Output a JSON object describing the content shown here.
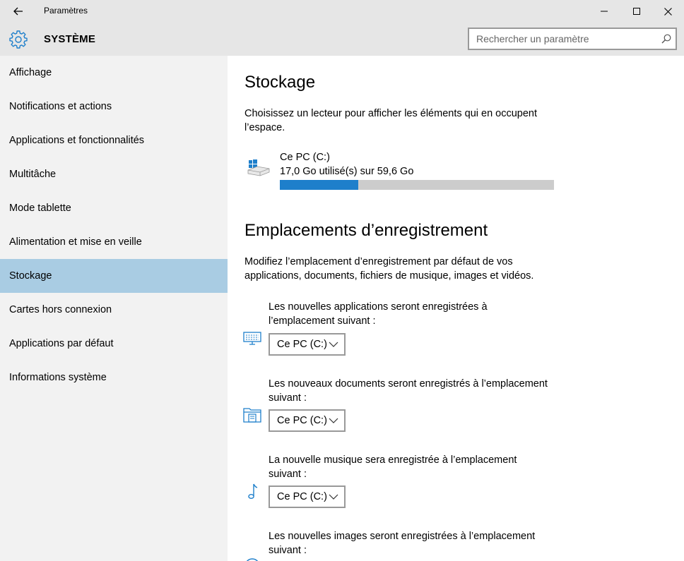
{
  "window": {
    "title": "Paramètres"
  },
  "header": {
    "section_title": "SYSTÈME",
    "search_placeholder": "Rechercher un paramètre"
  },
  "sidebar": {
    "items": [
      {
        "label": "Affichage",
        "active": false
      },
      {
        "label": "Notifications et actions",
        "active": false
      },
      {
        "label": "Applications et fonctionnalités",
        "active": false
      },
      {
        "label": "Multitâche",
        "active": false
      },
      {
        "label": "Mode tablette",
        "active": false
      },
      {
        "label": "Alimentation et mise en veille",
        "active": false
      },
      {
        "label": "Stockage",
        "active": true
      },
      {
        "label": "Cartes hors connexion",
        "active": false
      },
      {
        "label": "Applications par défaut",
        "active": false
      },
      {
        "label": "Informations système",
        "active": false
      }
    ]
  },
  "storage": {
    "title": "Stockage",
    "description": "Choisissez un lecteur pour afficher les éléments qui en occupent l’espace.",
    "drive": {
      "name": "Ce PC (C:)",
      "usage_text": "17,0 Go utilisé(s) sur 59,6 Go",
      "used_fraction": 0.285
    }
  },
  "save_locations": {
    "title": "Emplacements d’enregistrement",
    "description": "Modifiez l’emplacement d’enregistrement par défaut de vos applications, documents, fichiers de musique, images et vidéos.",
    "items": [
      {
        "label": "Les nouvelles applications seront enregistrées à l’emplacement suivant :",
        "value": "Ce PC (C:)",
        "icon": "monitor-icon"
      },
      {
        "label": "Les nouveaux documents seront enregistrés à l’emplacement suivant :",
        "value": "Ce PC (C:)",
        "icon": "documents-folder-icon"
      },
      {
        "label": "La nouvelle musique sera enregistrée à l’emplacement suivant :",
        "value": "Ce PC (C:)",
        "icon": "music-note-icon"
      },
      {
        "label": "Les nouvelles images seront enregistrées à l’emplacement suivant :",
        "value": "",
        "icon": "pictures-icon"
      }
    ]
  },
  "colors": {
    "accent": "#1e7fcb",
    "selection": "#a9cce3",
    "icon_blue": "#1e7fcb"
  }
}
